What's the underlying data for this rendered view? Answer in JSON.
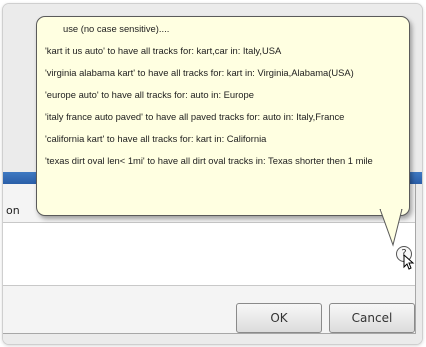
{
  "dialog": {
    "partial_label": "on",
    "ok_label": "OK",
    "cancel_label": "Cancel",
    "help_glyph": "?"
  },
  "tooltip": {
    "lines": [
      "use (no case sensitive)....",
      "'kart it us auto' to have all tracks for: kart,car  in: Italy,USA",
      "'virginia alabama kart' to have all tracks for: kart  in: Virginia,Alabama(USA)",
      "'europe auto' to have all tracks for: auto  in: Europe",
      "'italy france auto paved' to have all paved tracks for: auto  in: Italy,France",
      "'california kart' to have all tracks for: kart  in: California",
      "'texas dirt oval len< 1mi' to have all dirt oval tracks in: Texas shorter then 1 mile"
    ]
  },
  "colors": {
    "tooltip_bg": "#ffffe1",
    "title_bar": "#3f79c2"
  },
  "icons": {
    "help": "question-circle-icon",
    "cursor": "mouse-pointer-icon"
  }
}
